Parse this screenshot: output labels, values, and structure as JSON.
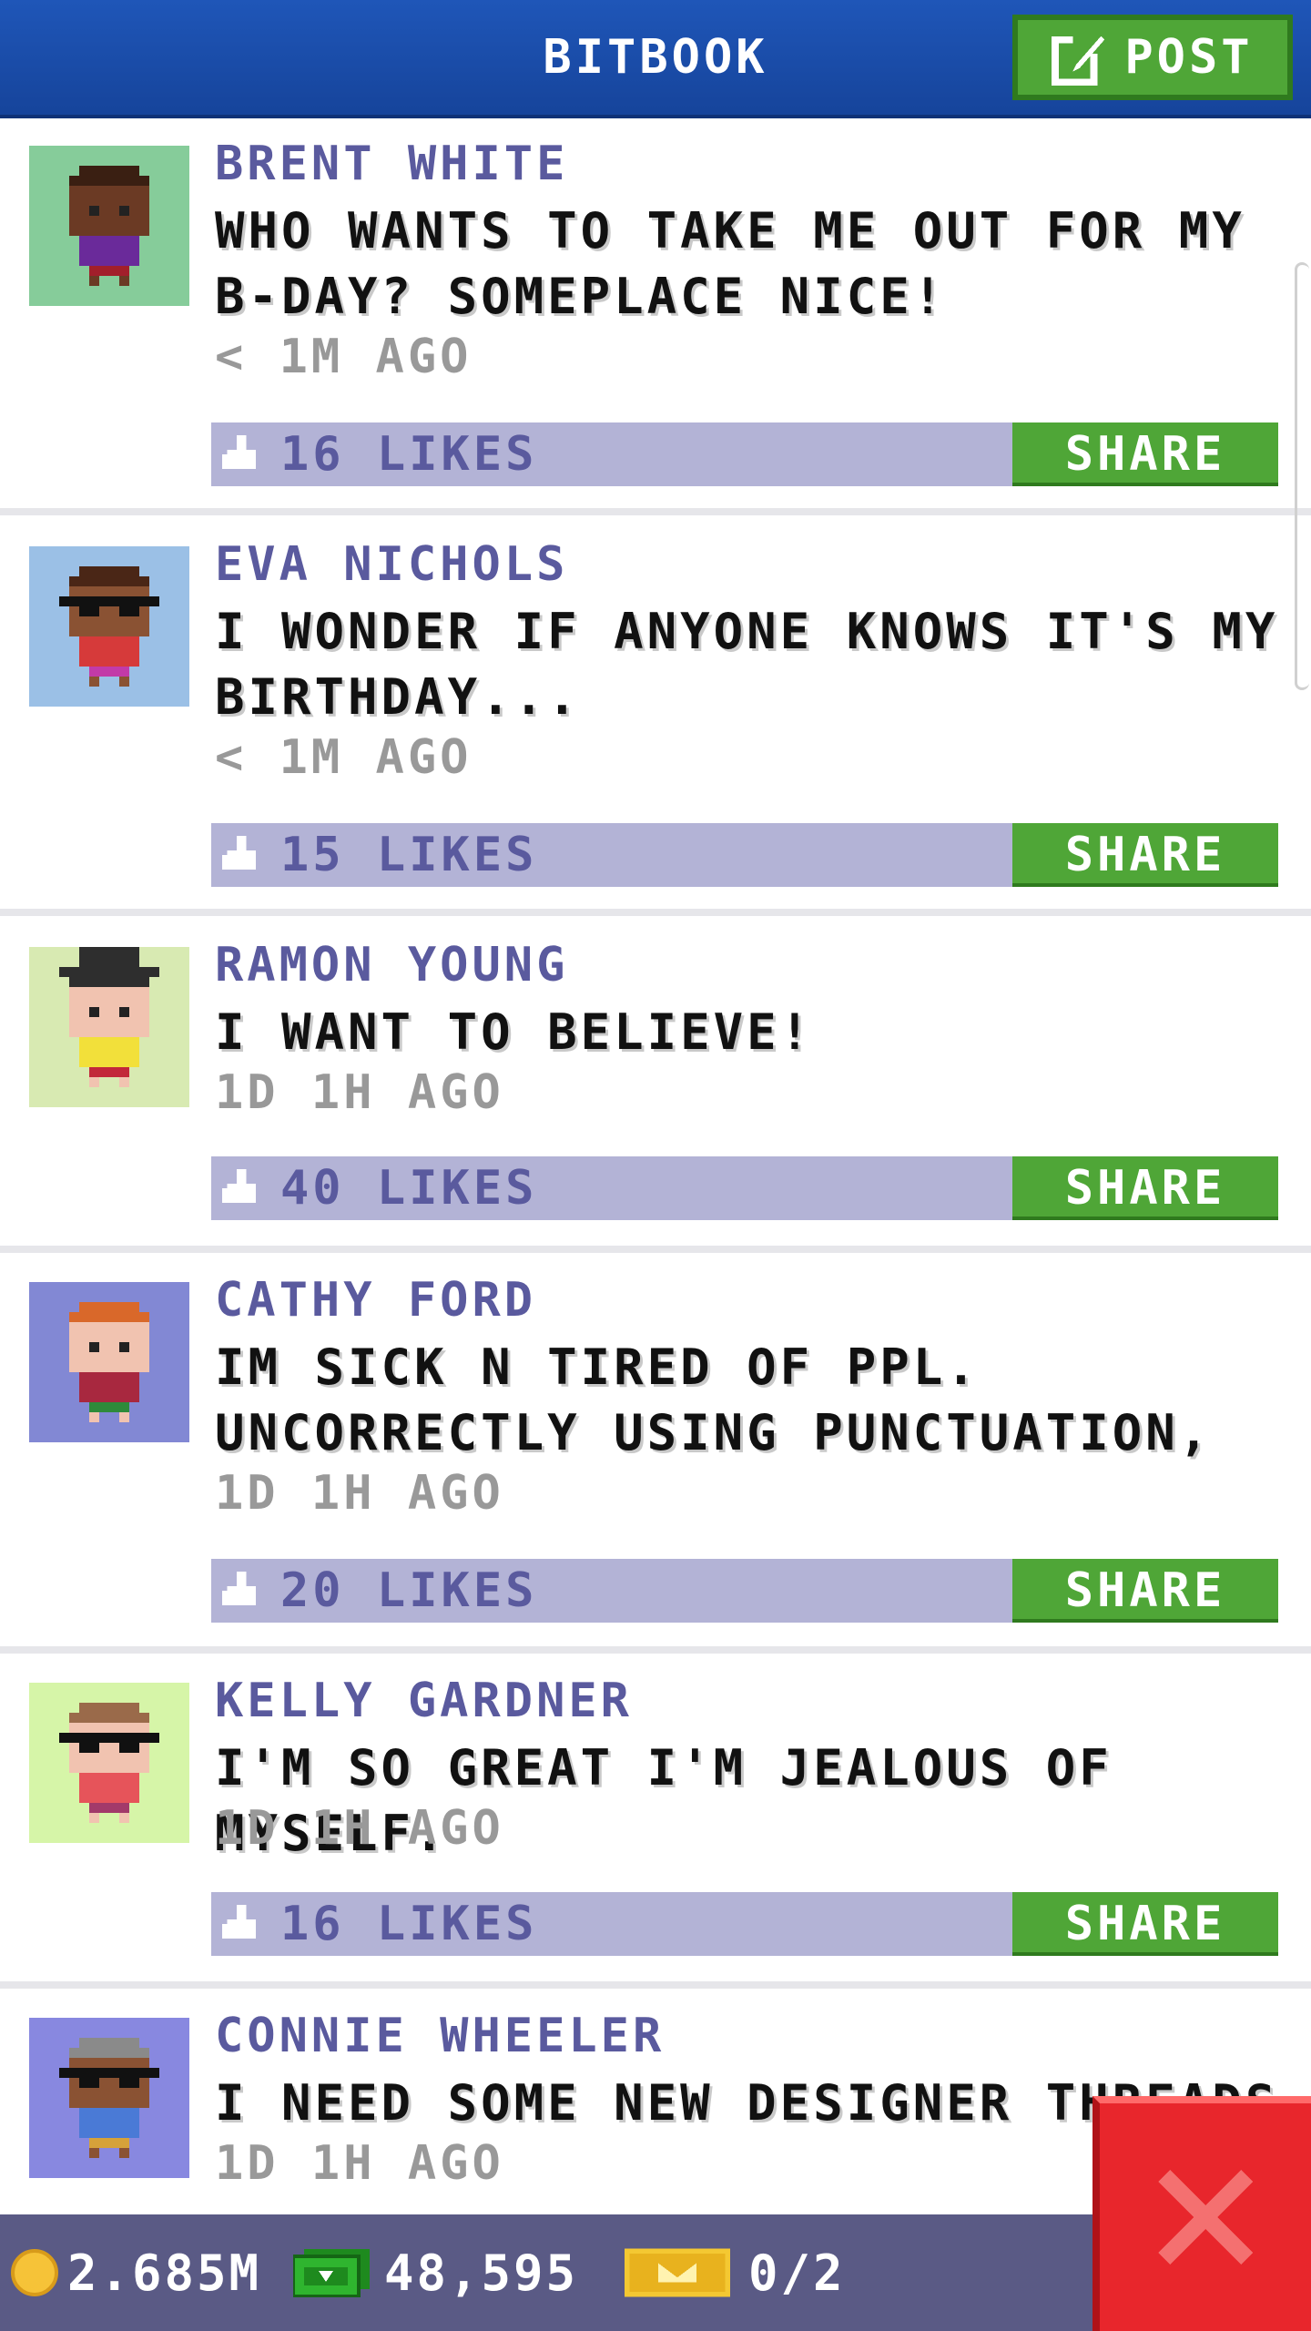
{
  "header": {
    "title": "BITBOOK",
    "post_label": "POST"
  },
  "posts": [
    {
      "name": "BRENT WHITE",
      "message": "WHO WANTS TO TAKE ME OUT FOR MY B-DAY? SOMEPLACE NICE!",
      "time": "< 1M AGO",
      "likes": "16 LIKES",
      "share": "SHARE",
      "avatar": {
        "bg": "#86cc9a",
        "skin": "#6b3a24",
        "hair": "#3a1f12",
        "shirt": "#6a2a9a",
        "pants": "#a21f2b",
        "glasses": false,
        "hat": false
      }
    },
    {
      "name": "EVA NICHOLS",
      "message": "I WONDER IF ANYONE KNOWS IT'S MY BIRTHDAY...",
      "time": "< 1M AGO",
      "likes": "15 LIKES",
      "share": "SHARE",
      "avatar": {
        "bg": "#9bc0e6",
        "skin": "#8a5233",
        "hair": "#4a2616",
        "shirt": "#d63a3a",
        "pants": "#c23aa8",
        "glasses": true,
        "hat": false
      }
    },
    {
      "name": "RAMON YOUNG",
      "message": "I WANT TO BELIEVE!",
      "time": "1D 1H AGO",
      "likes": "40 LIKES",
      "share": "SHARE",
      "avatar": {
        "bg": "#d8eab2",
        "skin": "#f1c3b0",
        "hair": "#2e2e2e",
        "shirt": "#f2e03a",
        "pants": "#c2283a",
        "glasses": false,
        "hat": true
      }
    },
    {
      "name": "CATHY FORD",
      "message": "IM SICK N TIRED OF PPL. UNCORRECTLY USING PUNCTUATION,",
      "time": "1D 1H AGO",
      "likes": "20 LIKES",
      "share": "SHARE",
      "avatar": {
        "bg": "#8288d4",
        "skin": "#f1c3b0",
        "hair": "#d9682a",
        "shirt": "#a8283f",
        "pants": "#2e8a3a",
        "glasses": false,
        "hat": false
      }
    },
    {
      "name": "KELLY GARDNER",
      "message": "I'M SO GREAT I'M JEALOUS OF MYSELF.",
      "time": "1D 1H AGO",
      "likes": "16 LIKES",
      "share": "SHARE",
      "avatar": {
        "bg": "#d6f5a8",
        "skin": "#f1c3b0",
        "hair": "#9a6a4a",
        "shirt": "#e6545a",
        "pants": "#a23a6a",
        "glasses": true,
        "hat": false
      }
    },
    {
      "name": "CONNIE WHEELER",
      "message": "I NEED SOME NEW DESIGNER THREADS",
      "time": "1D 1H AGO",
      "likes": "",
      "share": "",
      "avatar": {
        "bg": "#8888e0",
        "skin": "#8a5233",
        "hair": "#8a8a8a",
        "shirt": "#4a7ad6",
        "pants": "#d6a23a",
        "glasses": true,
        "hat": false
      }
    }
  ],
  "footer": {
    "coins": "2.685M",
    "bux": "48,595",
    "tickets": "0/2"
  },
  "colors": {
    "header": "#1f56b8",
    "accent_green": "#4fa637",
    "likes_bar": "#b3b3d6",
    "name_text": "#5a5a9e",
    "footer": "#5a5a85",
    "close": "#e8262c"
  }
}
